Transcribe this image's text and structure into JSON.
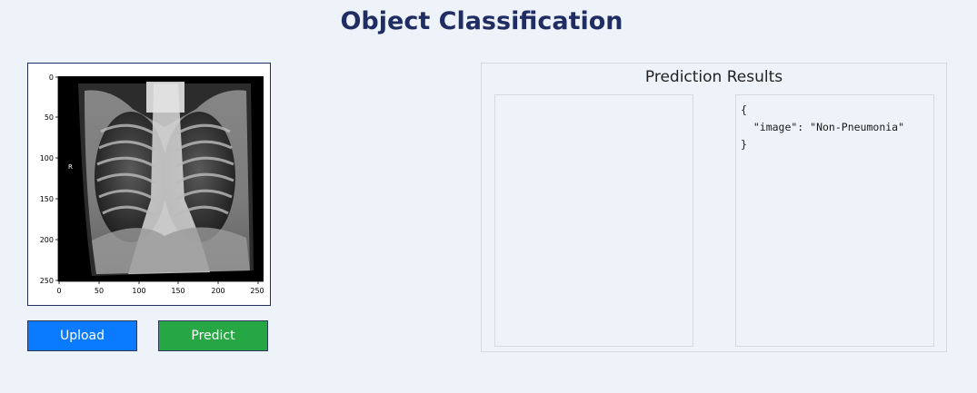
{
  "header": {
    "title": "Object Classification"
  },
  "image_panel": {
    "y_ticks": [
      "0",
      "50",
      "100",
      "150",
      "200",
      "250"
    ],
    "x_ticks": [
      "0",
      "50",
      "100",
      "150",
      "200",
      "250"
    ],
    "marker_letter": "R"
  },
  "buttons": {
    "upload_label": "Upload",
    "predict_label": "Predict",
    "upload_color": "#0a7bff",
    "predict_color": "#27a644"
  },
  "results": {
    "title": "Prediction Results",
    "output_lines": [
      "{",
      "  \"image\": \"Non-Pneumonia\"",
      "}"
    ]
  }
}
